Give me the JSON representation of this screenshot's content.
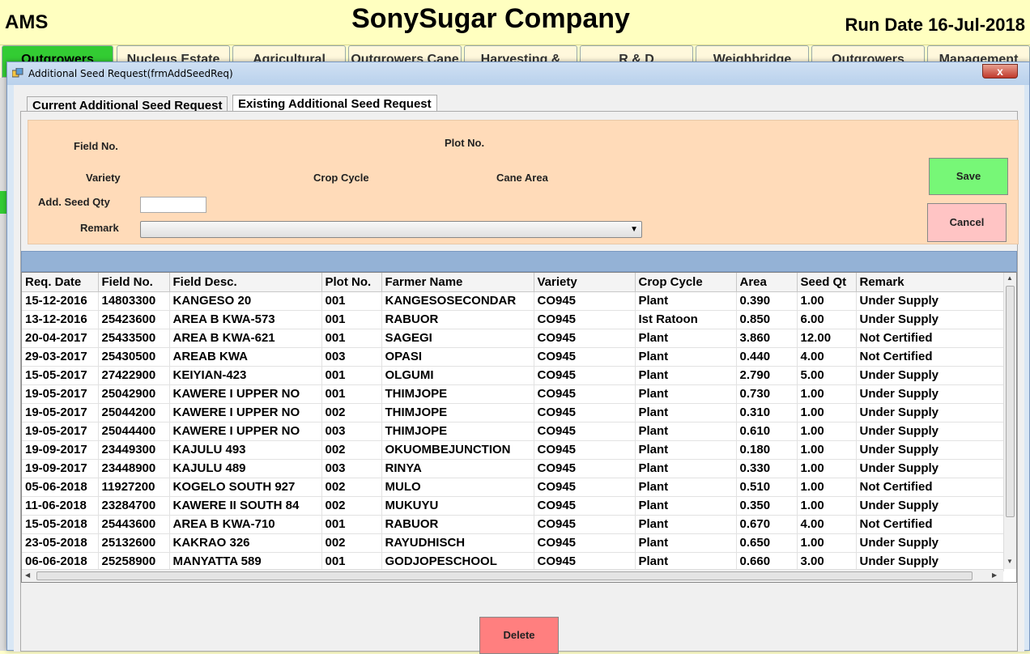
{
  "app": {
    "name": "AMS",
    "company": "SonySugar Company",
    "run_date": "Run Date 16-Jul-2018"
  },
  "nav_tabs": [
    {
      "label": "Outgrowers"
    },
    {
      "label": "Nucleus Estate"
    },
    {
      "label": "Agricultural Engineering"
    },
    {
      "label": "Outgrowers Cane Dev"
    },
    {
      "label": "Harvesting & Transport"
    },
    {
      "label": "R & D (Agronomy)"
    },
    {
      "label": "Weighbridge Operation"
    },
    {
      "label": "Outgrowers Accounts"
    },
    {
      "label": "Management"
    }
  ],
  "dialog": {
    "title": "Additional Seed Request(frmAddSeedReq)",
    "close": "x"
  },
  "tabs": [
    {
      "label": "Current Additional Seed Request"
    },
    {
      "label": "Existing Additional Seed Request"
    }
  ],
  "form": {
    "field_no_label": "Field No.",
    "plot_no_label": "Plot No.",
    "variety_label": "Variety",
    "crop_cycle_label": "Crop Cycle",
    "cane_area_label": "Cane Area",
    "seed_qty_label": "Add. Seed Qty",
    "seed_qty_value": "",
    "remark_label": "Remark",
    "remark_value": "",
    "save_label": "Save",
    "cancel_label": "Cancel"
  },
  "grid": {
    "columns": [
      "Req. Date",
      "Field No.",
      "Field Desc.",
      "Plot No.",
      "Farmer Name",
      "Variety",
      "Crop Cycle",
      "Area",
      "Seed Qt",
      "Remark"
    ],
    "rows": [
      [
        "15-12-2016",
        "14803300",
        "KANGESO 20",
        "001",
        "KANGESOSECONDAR",
        "CO945",
        "Plant",
        "0.390",
        "1.00",
        "Under Supply"
      ],
      [
        "13-12-2016",
        "25423600",
        "AREA B KWA-573",
        "001",
        "RABUOR",
        "CO945",
        "Ist Ratoon",
        "0.850",
        "6.00",
        "Under Supply"
      ],
      [
        "20-04-2017",
        "25433500",
        "AREA B KWA-621",
        "001",
        "SAGEGI",
        "CO945",
        "Plant",
        "3.860",
        "12.00",
        "Not Certified"
      ],
      [
        "29-03-2017",
        "25430500",
        "AREAB KWA",
        "003",
        "OPASI",
        "CO945",
        "Plant",
        "0.440",
        "4.00",
        "Not Certified"
      ],
      [
        "15-05-2017",
        "27422900",
        "KEIYIAN-423",
        "001",
        "OLGUMI",
        "CO945",
        "Plant",
        "2.790",
        "5.00",
        "Under Supply"
      ],
      [
        "19-05-2017",
        "25042900",
        "KAWERE I UPPER NO",
        "001",
        "THIMJOPE",
        "CO945",
        "Plant",
        "0.730",
        "1.00",
        "Under Supply"
      ],
      [
        "19-05-2017",
        "25044200",
        "KAWERE I UPPER NO",
        "002",
        "THIMJOPE",
        "CO945",
        "Plant",
        "0.310",
        "1.00",
        "Under Supply"
      ],
      [
        "19-05-2017",
        "25044400",
        "KAWERE I UPPER NO",
        "003",
        "THIMJOPE",
        "CO945",
        "Plant",
        "0.610",
        "1.00",
        "Under Supply"
      ],
      [
        "19-09-2017",
        "23449300",
        "KAJULU 493",
        "002",
        "OKUOMBEJUNCTION",
        "CO945",
        "Plant",
        "0.180",
        "1.00",
        "Under Supply"
      ],
      [
        "19-09-2017",
        "23448900",
        "KAJULU 489",
        "003",
        "RINYA",
        "CO945",
        "Plant",
        "0.330",
        "1.00",
        "Under Supply"
      ],
      [
        "05-06-2018",
        "11927200",
        "KOGELO SOUTH 927",
        "002",
        "MULO",
        "CO945",
        "Plant",
        "0.510",
        "1.00",
        "Not Certified"
      ],
      [
        "11-06-2018",
        "23284700",
        "KAWERE II SOUTH 84",
        "002",
        "MUKUYU",
        "CO945",
        "Plant",
        "0.350",
        "1.00",
        "Under Supply"
      ],
      [
        "15-05-2018",
        "25443600",
        "AREA B KWA-710",
        "001",
        "RABUOR",
        "CO945",
        "Plant",
        "0.670",
        "4.00",
        "Not Certified"
      ],
      [
        "23-05-2018",
        "25132600",
        "KAKRAO 326",
        "002",
        "RAYUDHISCH",
        "CO945",
        "Plant",
        "0.650",
        "1.00",
        "Under Supply"
      ],
      [
        "06-06-2018",
        "25258900",
        "MANYATTA 589",
        "001",
        "GODJOPESCHOOL",
        "CO945",
        "Plant",
        "0.660",
        "3.00",
        "Under Supply"
      ]
    ]
  },
  "delete_label": "Delete",
  "colors": {
    "header_bg": "#ffffc0",
    "form_bg": "#ffdbb9",
    "save_bg": "#77f777",
    "cancel_bg": "#ffc4c4",
    "delete_bg": "#ff7f7f",
    "grid_band": "#94b2d6"
  }
}
